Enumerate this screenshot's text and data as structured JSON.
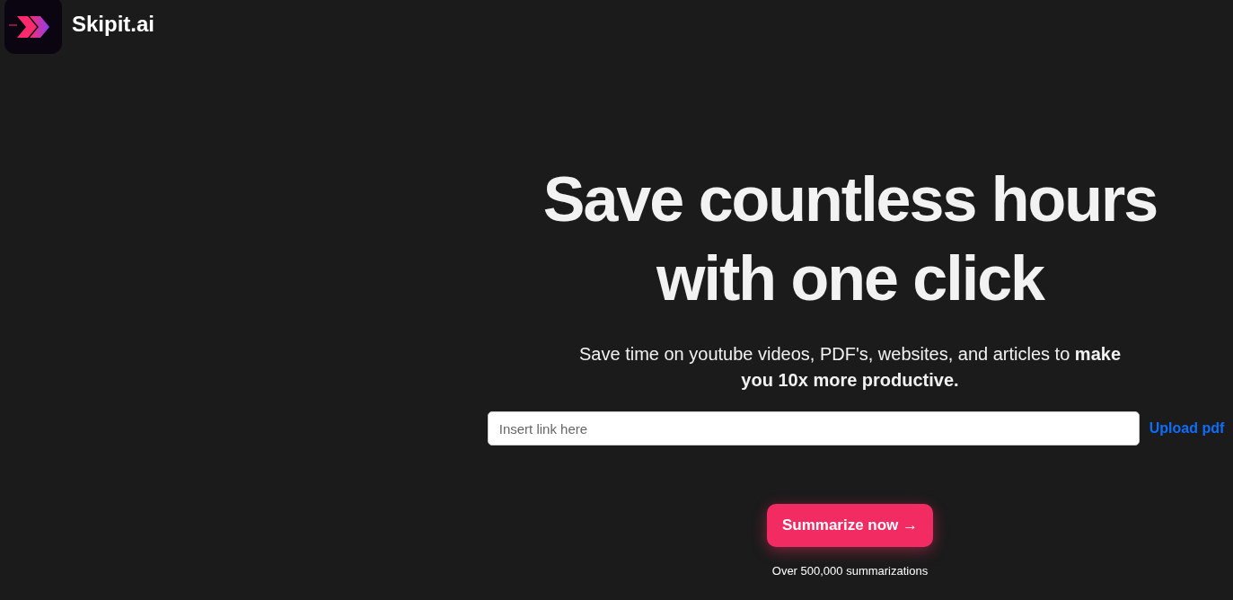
{
  "header": {
    "brand": "Skipit.ai"
  },
  "hero": {
    "headline_lines": [
      "Save countless hours",
      "with one click"
    ],
    "subtitle": "Save time on youtube videos, PDF's, websites, and articles to **make you 10x more productive.**"
  },
  "link_field": {
    "placeholder": "Insert link here"
  },
  "upload_link": "Upload pdf",
  "summarize_button": "Summarize now →",
  "counter": "Over 500,000 summarizations"
}
